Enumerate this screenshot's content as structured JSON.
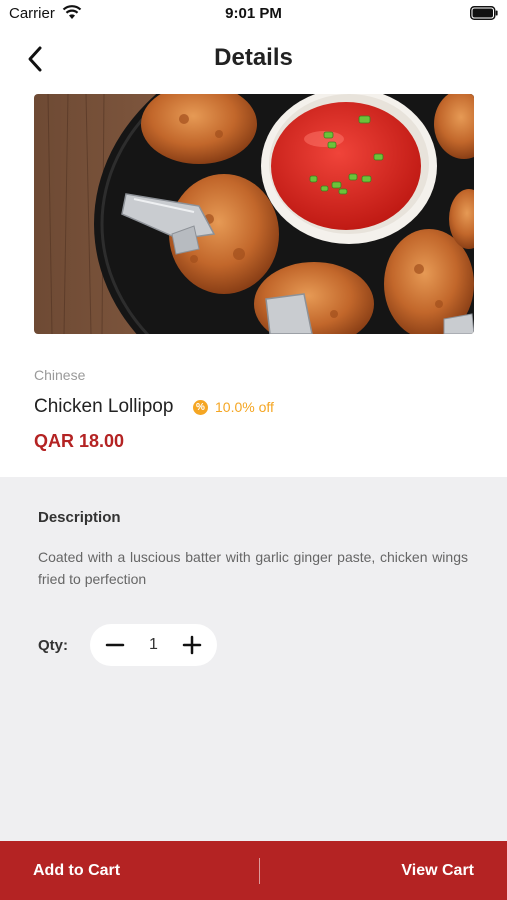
{
  "status_bar": {
    "carrier": "Carrier",
    "time": "9:01 PM"
  },
  "nav": {
    "title": "Details",
    "back_icon": "chevron-left-icon"
  },
  "product": {
    "image_alt": "Chicken lollipop with ketchup dip",
    "category": "Chinese",
    "name": "Chicken Lollipop",
    "discount": "10.0% off",
    "discount_icon": "discount-badge-icon",
    "price": "QAR 18.00"
  },
  "details": {
    "description_heading": "Description",
    "description_text": "Coated with a luscious batter with garlic ginger paste, chicken wings fried to perfection",
    "qty_label": "Qty:",
    "qty_value": "1"
  },
  "footer": {
    "add_to_cart": "Add to Cart",
    "view_cart": "View Cart"
  },
  "colors": {
    "accent_red": "#b42323",
    "discount_orange": "#f5a623",
    "panel_background": "#efeff1"
  }
}
